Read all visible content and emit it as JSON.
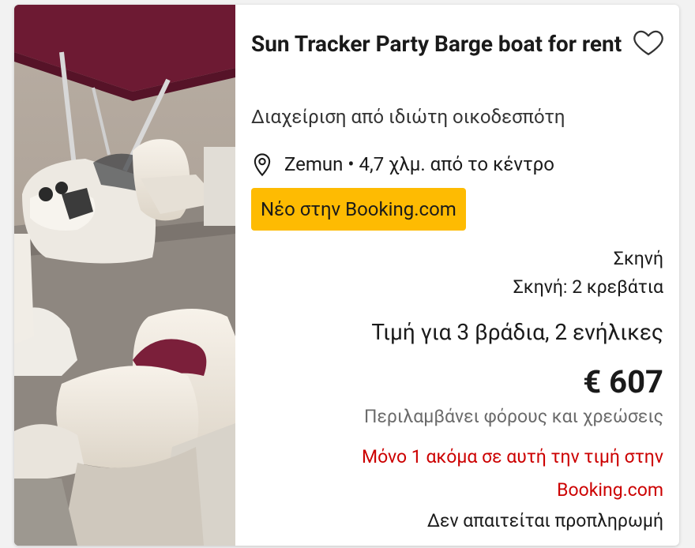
{
  "listing": {
    "title": "Sun Tracker Party Barge boat for rent",
    "host": "Διαχείριση από ιδιώτη οικοδεσπότη",
    "location": "Zemun",
    "distance": "4,7 χλμ. από το κέντρο",
    "location_separator": "•",
    "badge": "Νέο στην Booking.com",
    "room_type": "Σκηνή",
    "beds": "Σκηνή: 2 κρεβάτια",
    "nights_guests": "Τιμή για 3 βράδια, 2 ενήλικες",
    "price": "€ 607",
    "taxes_note": "Περιλαμβάνει φόρους και χρεώσεις",
    "scarcity_line1": "Μόνο 1 ακόμα σε αυτή την τιμή στην",
    "scarcity_line2": "Booking.com",
    "prepayment": "Δεν απαιτείται προπληρωμή"
  },
  "icons": {
    "favorite": "heart-outline-icon",
    "location": "map-pin-icon"
  },
  "colors": {
    "badge": "#febb02",
    "scarcity": "#cc0000",
    "canopy": "#7b1f3a"
  }
}
